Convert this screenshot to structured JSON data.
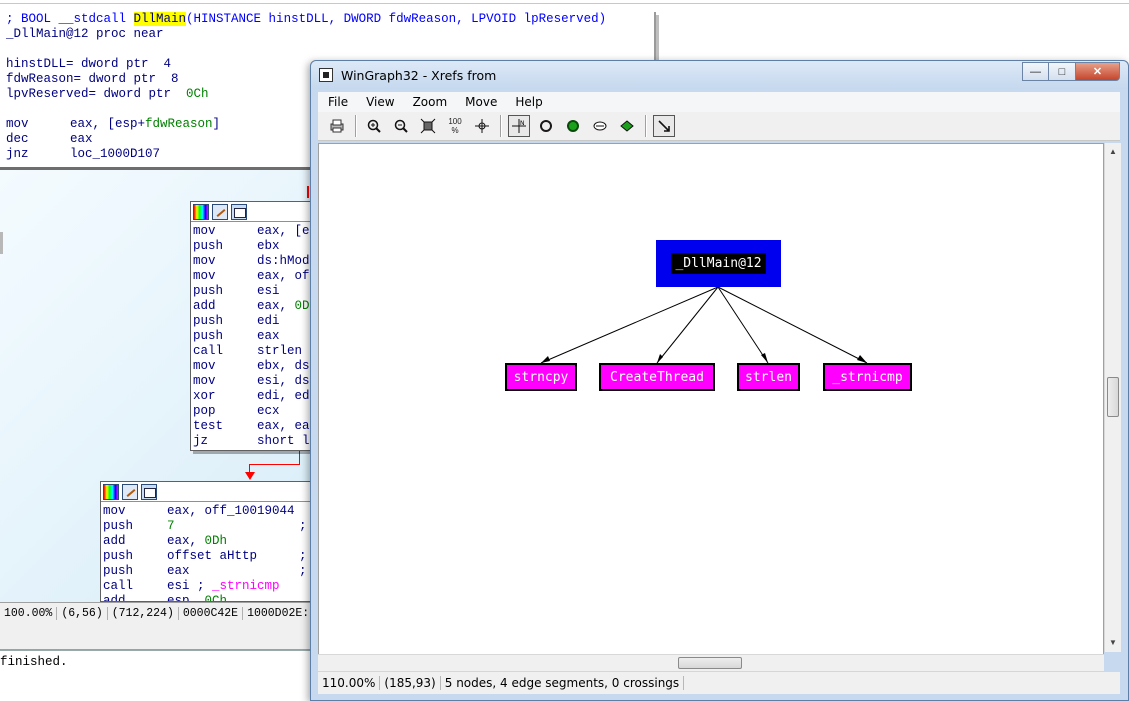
{
  "ida": {
    "header_lines": {
      "proto_prefix": "; BOOL __stdcall ",
      "proto_func": "DllMain",
      "proto_args": "(HINSTANCE hinstDLL, DWORD fdwReason, LPVOID lpReserved)",
      "proc_line": "_DllMain@12 proc near",
      "var1": "hinstDLL= dword ptr  4",
      "var2": "fdwReason= dword ptr  8",
      "var3_name": "lpvReserved= dword ptr  ",
      "var3_val": "0Ch",
      "ins1_mn": "mov",
      "ins1_op": "eax, [esp+",
      "ins1_sym": "fdwReason",
      "ins1_end": "]",
      "ins2_mn": "dec",
      "ins2_op": "eax",
      "ins3_mn": "jnz",
      "ins3_op": "loc_1000D107"
    },
    "block2": [
      {
        "mn": "mov",
        "op": "eax, [e"
      },
      {
        "mn": "push",
        "op": "ebx"
      },
      {
        "mn": "mov",
        "op": "ds:hMod"
      },
      {
        "mn": "mov",
        "op": "eax, of"
      },
      {
        "mn": "push",
        "op": "esi"
      },
      {
        "mn": "add",
        "op": "eax, 0D"
      },
      {
        "mn": "push",
        "op": "edi"
      },
      {
        "mn": "push",
        "op": "eax"
      },
      {
        "mn": "call",
        "op": "strlen"
      },
      {
        "mn": "mov",
        "op": "ebx, ds"
      },
      {
        "mn": "mov",
        "op": "esi, ds"
      },
      {
        "mn": "xor",
        "op": "edi, ed"
      },
      {
        "mn": "pop",
        "op": "ecx"
      },
      {
        "mn": "test",
        "op": "eax, ea"
      },
      {
        "mn": "jz",
        "op": "short l"
      }
    ],
    "block3": [
      {
        "mn": "mov",
        "op": "eax, off_10019044"
      },
      {
        "mn": "push",
        "op": "7",
        "tail": ";"
      },
      {
        "mn": "add",
        "op": "eax, 0Dh"
      },
      {
        "mn": "push",
        "op": "offset aHttp",
        "tail": ";"
      },
      {
        "mn": "push",
        "op": "eax",
        "tail": ";"
      },
      {
        "mn": "call",
        "op": "esi ; _strnicmp"
      },
      {
        "mn": "add",
        "op": "esp, 0Ch"
      }
    ],
    "status": {
      "zoom": "100.00%",
      "coords": "(6,56)",
      "pos": "(712,224)",
      "offset": "0000C42E",
      "address": "1000D02E:"
    },
    "output_text": "finished."
  },
  "wingraph": {
    "title": "WinGraph32 - Xrefs from",
    "menu": [
      "File",
      "View",
      "Zoom",
      "Move",
      "Help"
    ],
    "toolbar": {
      "print": "print-icon",
      "zoom_in": "zoom-in-icon",
      "zoom_out": "zoom-out-icon",
      "fit": "fit-icon",
      "zoom_100_label": "100",
      "center": "center-icon",
      "pointer": "pointer-icon"
    },
    "nodes": {
      "root": "_DllMain@12",
      "children": [
        "strncpy",
        "CreateThread",
        "strlen",
        "_strnicmp"
      ]
    },
    "colors": {
      "root_fill": "#0000ee",
      "child_fill": "#ff00ff"
    },
    "status": {
      "zoom": "110.00%",
      "coords": "(185,93)",
      "info": "5 nodes, 4 edge segments, 0 crossings"
    }
  }
}
